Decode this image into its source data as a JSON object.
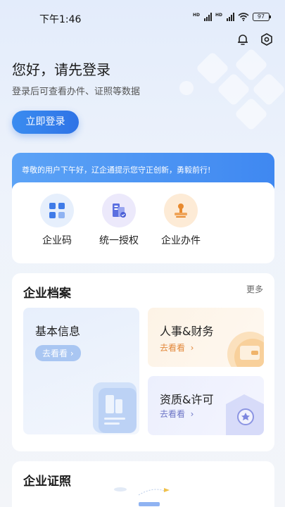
{
  "status": {
    "time": "下午1:46",
    "battery": "97"
  },
  "header": {
    "greeting": "您好，请先登录",
    "subtitle": "登录后可查看办件、证照等数据",
    "login_label": "立即登录"
  },
  "quick": {
    "banner": "尊敬的用户下午好，辽企通提示您守正创新，勇毅前行!",
    "items": [
      {
        "label": "企业码",
        "icon": "qrcode-icon"
      },
      {
        "label": "统一授权",
        "icon": "authorization-icon"
      },
      {
        "label": "企业办件",
        "icon": "stamp-icon"
      }
    ]
  },
  "archive": {
    "title": "企业档案",
    "more": "更多",
    "tiles": [
      {
        "title": "基本信息",
        "cta": "去看看",
        "icon": "building-icon"
      },
      {
        "title": "人事&财务",
        "cta": "去看看",
        "icon": "wallet-icon"
      },
      {
        "title": "资质&许可",
        "cta": "去看看",
        "icon": "certificate-icon"
      }
    ]
  },
  "certs": {
    "title": "企业证照"
  },
  "colors": {
    "accent": "#2f73e6",
    "hr_accent": "#e2883b",
    "qual_accent": "#6e76c6"
  }
}
